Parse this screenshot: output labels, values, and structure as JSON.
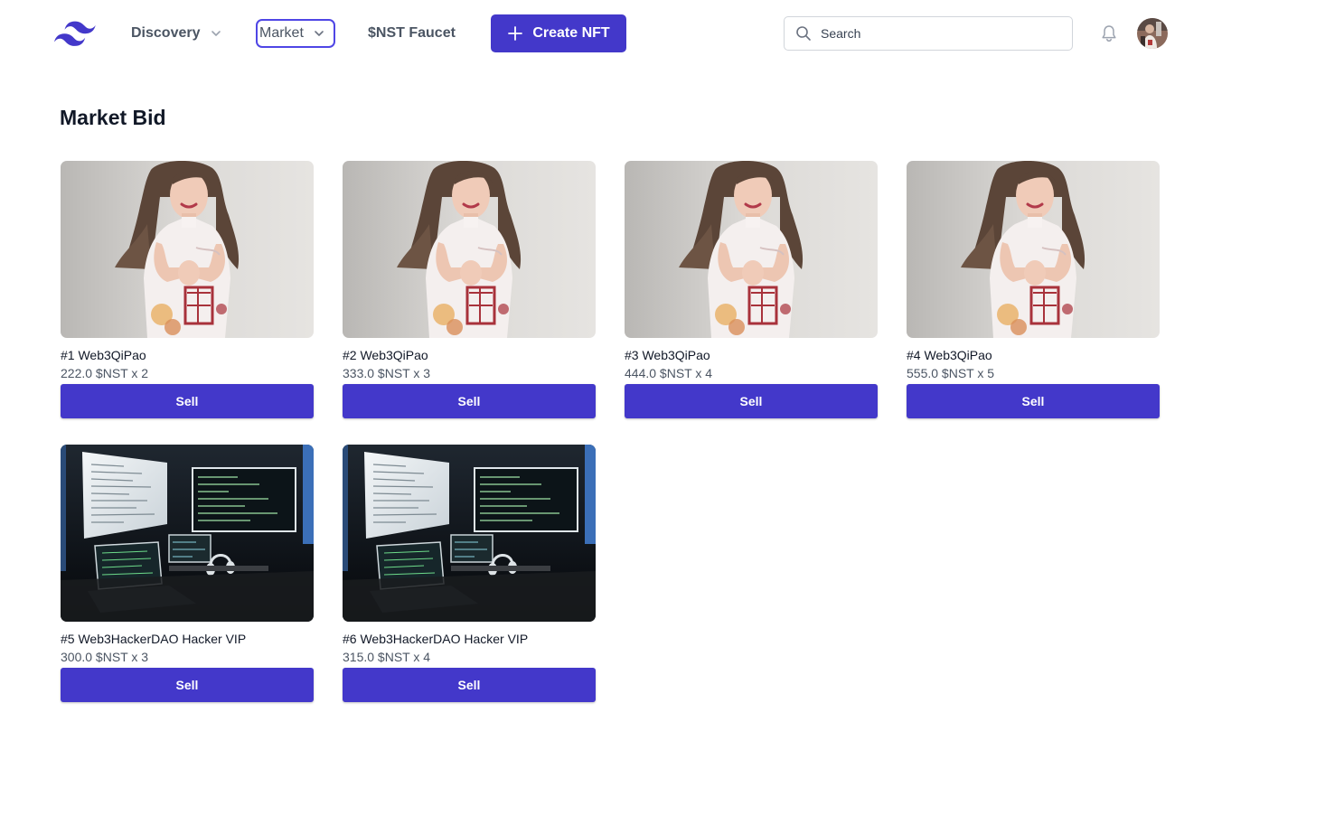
{
  "nav": {
    "discovery_label": "Discovery",
    "market_label": "Market",
    "faucet_label": "$NST Faucet",
    "create_label": "Create NFT"
  },
  "search": {
    "placeholder": "Search",
    "value": ""
  },
  "main": {
    "title": "Market Bid",
    "sell_label": "Sell",
    "items": [
      {
        "name": "#1 Web3QiPao",
        "price": "222.0 $NST x 2",
        "image": "qipao-photo"
      },
      {
        "name": "#2 Web3QiPao",
        "price": "333.0 $NST x 3",
        "image": "qipao-photo"
      },
      {
        "name": "#3 Web3QiPao",
        "price": "444.0 $NST x 4",
        "image": "qipao-photo"
      },
      {
        "name": "#4 Web3QiPao",
        "price": "555.0 $NST x 5",
        "image": "qipao-photo"
      },
      {
        "name": "#5 Web3HackerDAO Hacker VIP",
        "price": "300.0 $NST x 3",
        "image": "hacker-desk-photo"
      },
      {
        "name": "#6 Web3HackerDAO Hacker VIP",
        "price": "315.0 $NST x 4",
        "image": "hacker-desk-photo"
      }
    ]
  },
  "icons": {
    "logo": "tailwind-wave-logo",
    "search": "search-icon",
    "bell": "bell-icon",
    "plus": "plus-icon",
    "chevron": "chevron-down-icon"
  },
  "colors": {
    "accent": "#4338ca",
    "accent_border": "#4f46e5"
  }
}
